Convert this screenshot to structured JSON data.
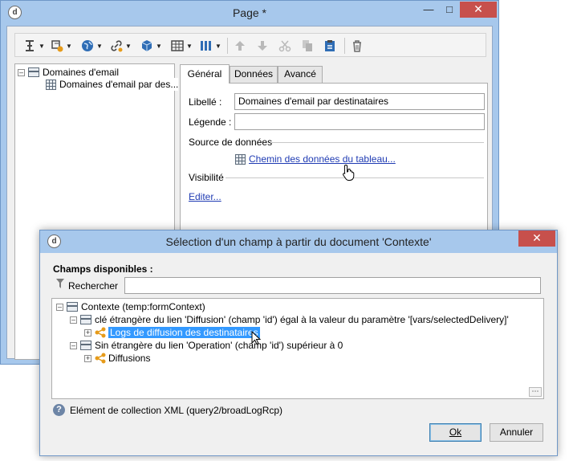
{
  "back_window": {
    "title": "Page *",
    "app_icon": "adobe-campaign-icon",
    "toolbar": {
      "buttons": [
        "insert-field-icon",
        "add-element-icon",
        "globe-icon",
        "link-icon",
        "cube-icon",
        "table-icon",
        "columns-icon",
        "move-up-icon",
        "move-down-icon",
        "cut-icon",
        "copy-icon",
        "paste-icon",
        "delete-icon"
      ]
    },
    "tree": {
      "root": "Domaines d'email",
      "child": "Domaines d'email par des..."
    },
    "tabs": [
      "Général",
      "Données",
      "Avancé"
    ],
    "general": {
      "libelle_label": "Libellé :",
      "libelle_value": "Domaines d'email par destinataires",
      "legende_label": "Légende :",
      "legende_value": "",
      "source_label": "Source de données",
      "source_link": "Chemin des données du tableau...",
      "visibilite_label": "Visibilité",
      "editer_link": "Editer..."
    }
  },
  "dialog": {
    "title": "Sélection d'un champ à partir du document 'Contexte'",
    "fields_label": "Champs disponibles :",
    "search_label": "Rechercher",
    "search_value": "",
    "tree": {
      "root": "Contexte (temp:formContext)",
      "node1": "clé étrangère du lien 'Diffusion' (champ 'id') égal à la valeur du paramètre '[vars/selectedDelivery]'",
      "node1_child": "Logs de diffusion des destinataires",
      "node2": "Sin étrangère du lien 'Operation' (champ 'id') supérieur à 0",
      "node2_child": "Diffusions"
    },
    "status_text": "Elément de collection XML (query2/broadLogRcp)",
    "ok_button": "Ok",
    "cancel_button": "Annuler"
  },
  "colors": {
    "title_bar": "#a7c8ec",
    "close_button": "#c7504c",
    "selection": "#3399ff",
    "link": "#1f3bb3"
  }
}
